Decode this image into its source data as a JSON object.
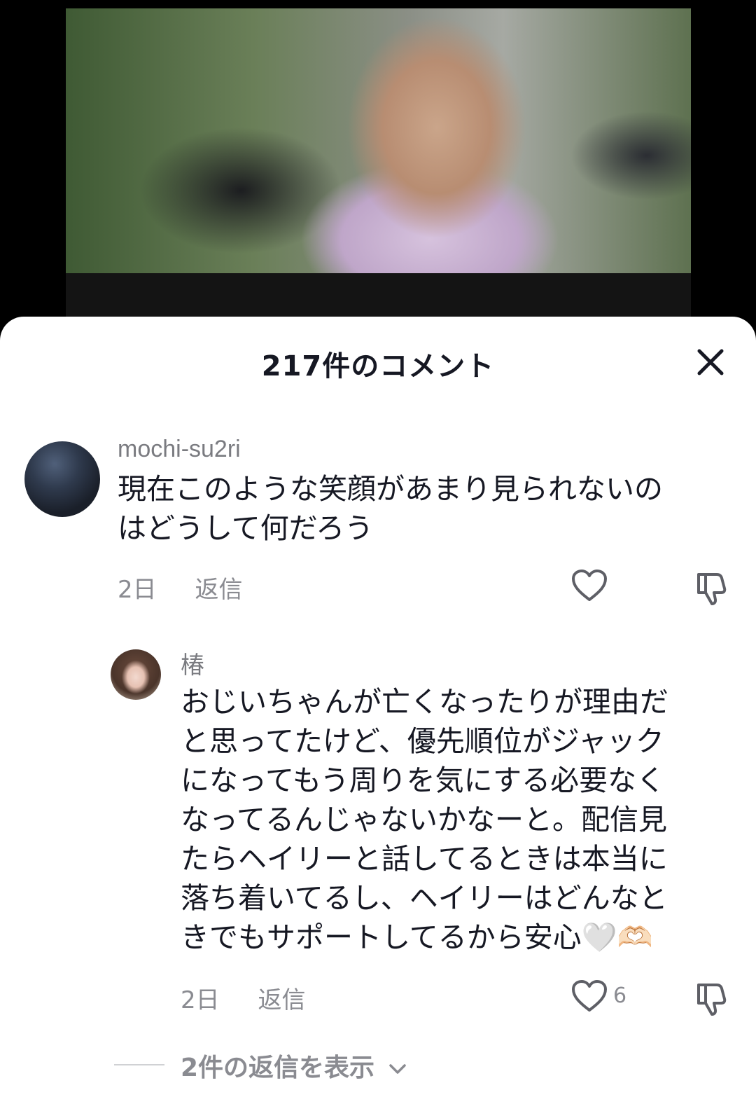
{
  "sheet": {
    "title": "217件のコメント",
    "close_icon": "close-icon"
  },
  "comments": [
    {
      "username": "mochi-su2ri",
      "text": "現在このような笑顔があまり見られないの\nはどうして何だろう",
      "age": "2日",
      "reply_label": "返信",
      "like_count": ""
    }
  ],
  "replies": [
    {
      "username": "椿",
      "text": "おじいちゃんが亡くなったりが理由だ\nと思ってたけど、優先順位がジャック\nになってもう周りを気にする必要なく\nなってるんじゃないかなーと。配信見\nたらヘイリーと話してるときは本当に\n落ち着いてるし、ヘイリーはどんなと\nきでもサポートしてるから安心🤍🫶🏻",
      "age": "2日",
      "reply_label": "返信",
      "like_count": "6"
    }
  ],
  "view_replies_label": "2件の返信を表示",
  "colors": {
    "text": "#161823",
    "muted": "#8a8b91",
    "sheet": "#ffffff"
  }
}
